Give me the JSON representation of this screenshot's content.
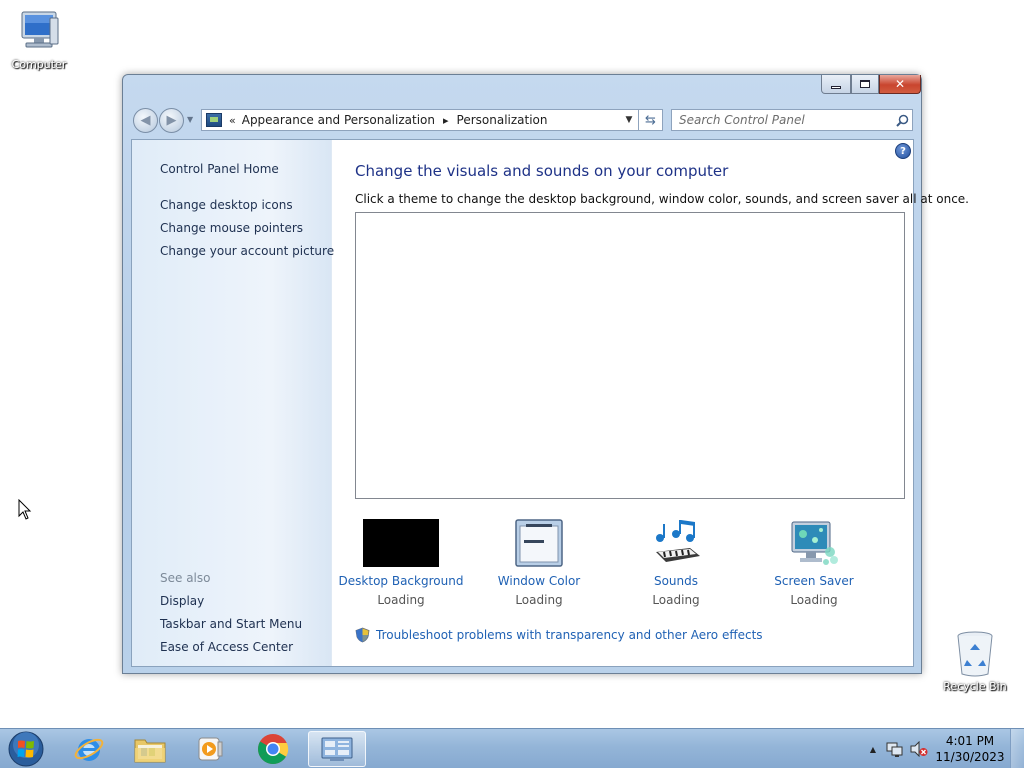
{
  "desktop": {
    "computer_label": "Computer",
    "recycle_label": "Recycle Bin"
  },
  "window": {
    "caption_buttons": {
      "minimize": "minimize",
      "maximize": "maximize",
      "close": "close"
    },
    "address": {
      "root_chevron": "«",
      "crumbs": [
        "Appearance and Personalization",
        "Personalization"
      ]
    },
    "search": {
      "placeholder": "Search Control Panel"
    },
    "left_pane": {
      "home": "Control Panel Home",
      "tasks": [
        "Change desktop icons",
        "Change mouse pointers",
        "Change your account picture"
      ],
      "see_also_label": "See also",
      "see_also": [
        "Display",
        "Taskbar and Start Menu",
        "Ease of Access Center"
      ]
    },
    "main": {
      "title": "Change the visuals and sounds on your computer",
      "description": "Click a theme to change the desktop background, window color, sounds, and screen saver all at once.",
      "settings": [
        {
          "name": "Desktop Background",
          "status": "Loading",
          "icon": "desktop-background-icon"
        },
        {
          "name": "Window Color",
          "status": "Loading",
          "icon": "window-color-icon"
        },
        {
          "name": "Sounds",
          "status": "Loading",
          "icon": "sounds-icon"
        },
        {
          "name": "Screen Saver",
          "status": "Loading",
          "icon": "screen-saver-icon"
        }
      ],
      "troubleshoot": "Troubleshoot problems with transparency and other Aero effects"
    }
  },
  "taskbar": {
    "pinned": [
      "internet-explorer",
      "windows-explorer",
      "media-player",
      "chrome",
      "control-panel"
    ],
    "clock": {
      "time": "4:01 PM",
      "date": "11/30/2023"
    }
  },
  "colors": {
    "link": "#1f61b4",
    "title": "#1e3287",
    "taskbar": "#94b5d8"
  }
}
